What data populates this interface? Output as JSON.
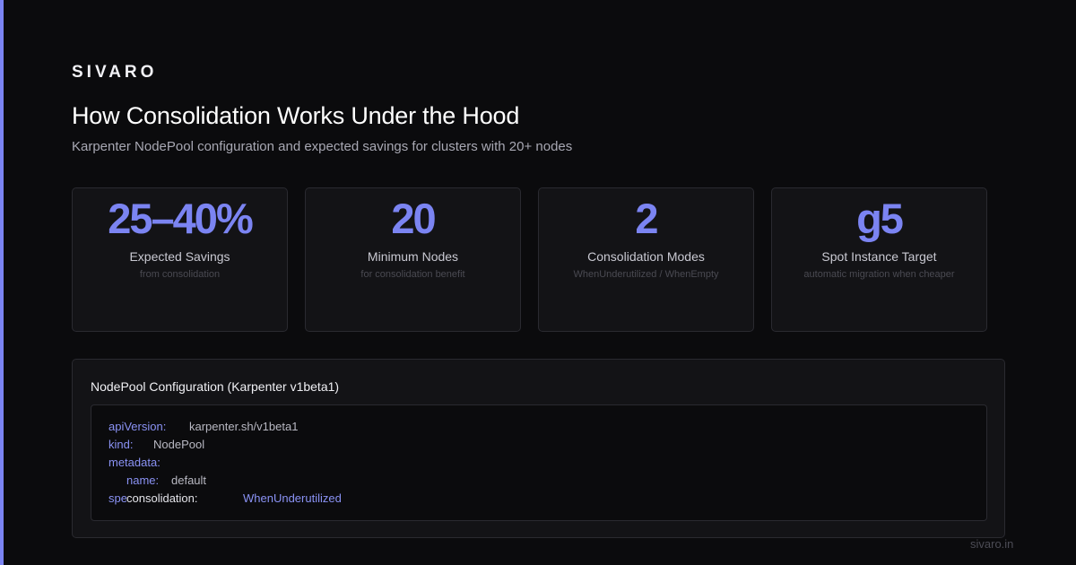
{
  "brand": "SIVARO",
  "title": "How Consolidation Works Under the Hood",
  "subtitle": "Karpenter NodePool configuration and expected savings for clusters with 20+ nodes",
  "colors": {
    "accent": "#7b84f2",
    "background": "#0b0b0d",
    "card": "#131316",
    "border": "#2a2a30"
  },
  "cards": [
    {
      "value": "25–40%",
      "label": "Expected Savings",
      "note": "from consolidation"
    },
    {
      "value": "20",
      "label": "Minimum Nodes",
      "note": "for consolidation benefit"
    },
    {
      "value": "2",
      "label": "Consolidation Modes",
      "note": "WhenUnderutilized / WhenEmpty"
    },
    {
      "value": "g5",
      "label": "Spot Instance Target",
      "note": "automatic migration when cheaper"
    }
  ],
  "config": {
    "title": "NodePool Configuration (Karpenter v1beta1)",
    "lines": [
      {
        "key": "apiVersion:",
        "value": "karpenter.sh/v1beta1"
      },
      {
        "key": "kind:",
        "value": "NodePool"
      },
      {
        "key": "metadata:",
        "value": ""
      },
      {
        "key": "name:",
        "value": "default"
      },
      {
        "key": "spec:",
        "overlay": "consolidation:",
        "value": "WhenUnderutilized"
      }
    ]
  },
  "footer": "sivaro.in"
}
